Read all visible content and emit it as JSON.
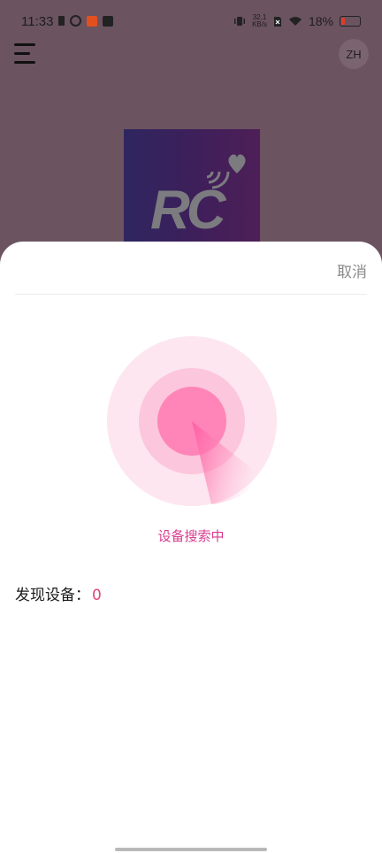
{
  "status_bar": {
    "time": "11:33",
    "net_speed_value": "32.1",
    "net_speed_unit": "KB/s",
    "battery_percent": "18%",
    "battery_level": 0.18
  },
  "header": {
    "avatar_label": "ZH"
  },
  "logo": {
    "text": "RC"
  },
  "sheet": {
    "cancel_label": "取消",
    "search_status": "设备搜索中",
    "found_label": "发现设备：",
    "found_count": "0"
  },
  "colors": {
    "accent": "#d83d8f",
    "count": "#e0457c",
    "overlay": "#6b5360",
    "radar_outer": "#fde6ef",
    "radar_mid": "#fcc6dc",
    "radar_inner": "#ff85b8"
  }
}
